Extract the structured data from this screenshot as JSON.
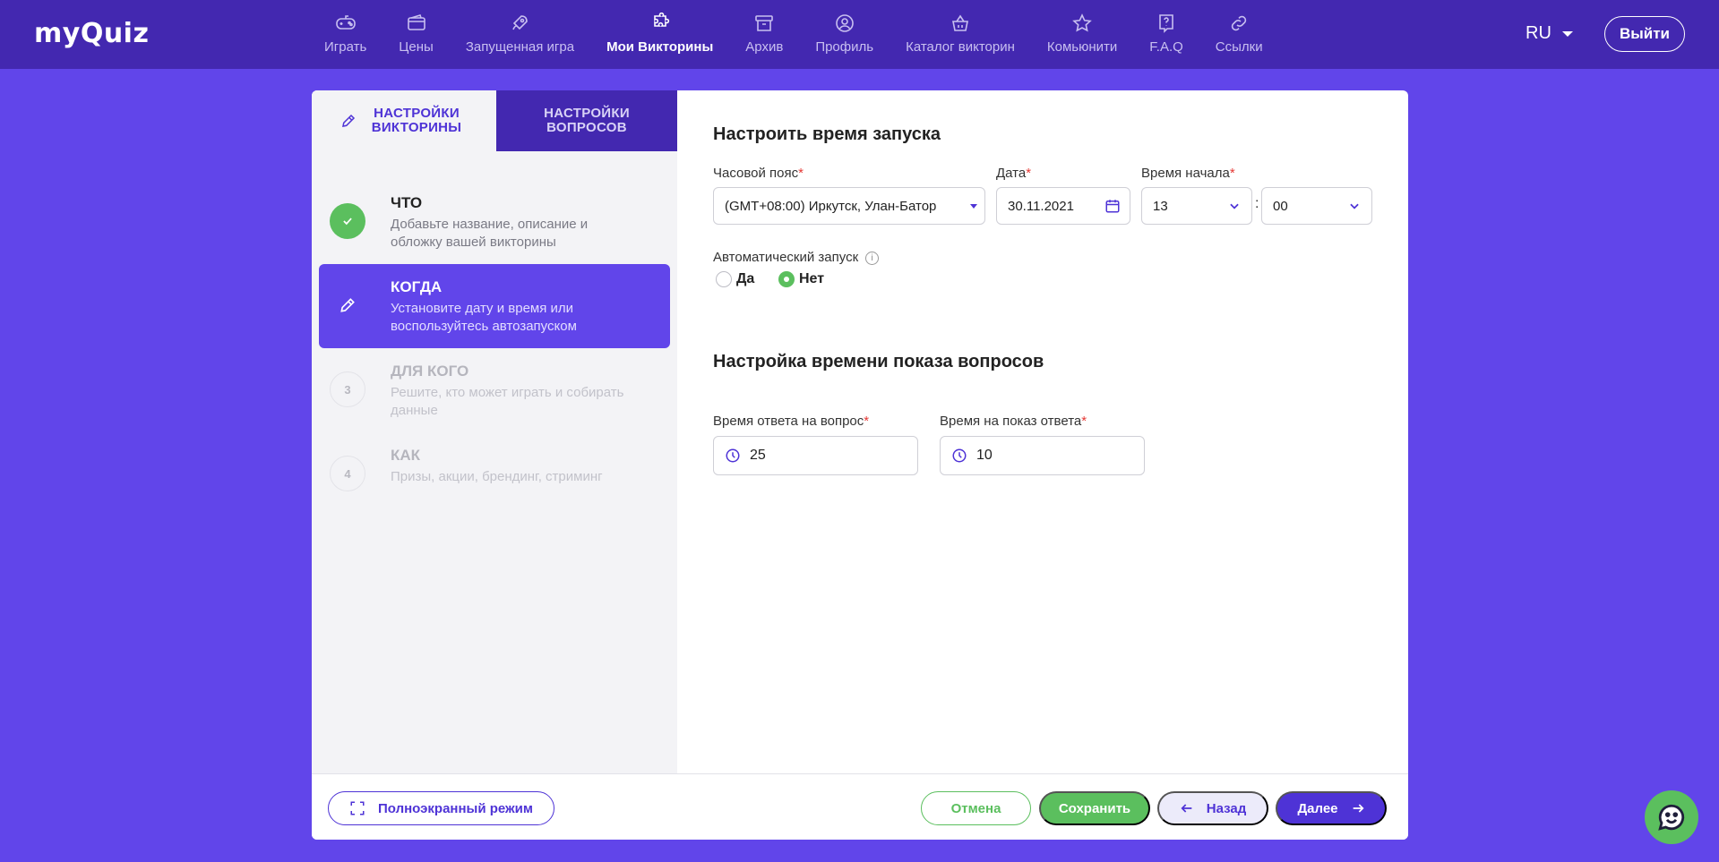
{
  "brand": {
    "logo": "myQuiz"
  },
  "nav": [
    {
      "label": "Играть",
      "icon": "gamepad-icon"
    },
    {
      "label": "Цены",
      "icon": "wallet-icon"
    },
    {
      "label": "Запущенная игра",
      "icon": "rocket-icon"
    },
    {
      "label": "Мои Викторины",
      "icon": "puzzle-icon",
      "active": true
    },
    {
      "label": "Архив",
      "icon": "archive-icon"
    },
    {
      "label": "Профиль",
      "icon": "user-circle-icon"
    },
    {
      "label": "Каталог викторин",
      "icon": "basket-icon"
    },
    {
      "label": "Комьюнити",
      "icon": "star-icon"
    },
    {
      "label": "F.A.Q",
      "icon": "help-icon"
    },
    {
      "label": "Ссылки",
      "icon": "link-icon"
    }
  ],
  "header": {
    "lang": "RU",
    "logout": "Выйти"
  },
  "tabs": {
    "quiz_settings": "НАСТРОЙКИ ВИКТОРИНЫ",
    "question_settings": "НАСТРОЙКИ ВОПРОСОВ"
  },
  "steps": [
    {
      "marker": "",
      "title": "ЧТО",
      "desc": "Добавьте название, описание и обложку вашей викторины",
      "state": "done"
    },
    {
      "marker": "",
      "title": "КОГДА",
      "desc": "Установите дату и время или воспользуйтесь автозапуском",
      "state": "active"
    },
    {
      "marker": "3",
      "title": "ДЛЯ КОГО",
      "desc": "Решите, кто может играть и собирать данные",
      "state": "pending"
    },
    {
      "marker": "4",
      "title": "КАК",
      "desc": "Призы, акции, брендинг, стриминг",
      "state": "pending"
    }
  ],
  "launch": {
    "heading": "Настроить время запуска",
    "timezone_label": "Часовой пояс",
    "timezone_value": "(GMT+08:00) Иркутск, Улан-Батор",
    "date_label": "Дата",
    "date_value": "30.11.2021",
    "start_label": "Время начала",
    "hour_value": "13",
    "minute_value": "00",
    "separator": ":",
    "required_mark": "*",
    "auto_label": "Автоматический запуск",
    "info_glyph": "i",
    "yes": "Да",
    "no": "Нет",
    "auto_selected": "no"
  },
  "question_time": {
    "heading": "Настройка времени показа вопросов",
    "answer_label": "Время ответа на вопрос",
    "answer_value": "25",
    "show_label": "Время на показ ответа",
    "show_value": "10"
  },
  "footer": {
    "fullscreen": "Полноэкранный режим",
    "cancel": "Отмена",
    "save": "Сохранить",
    "back": "Назад",
    "next": "Далее"
  },
  "colors": {
    "primary": "#6145ea",
    "header": "#4328b0",
    "accent": "#4e33d6",
    "success": "#5bbf5e",
    "required": "#e53935"
  }
}
